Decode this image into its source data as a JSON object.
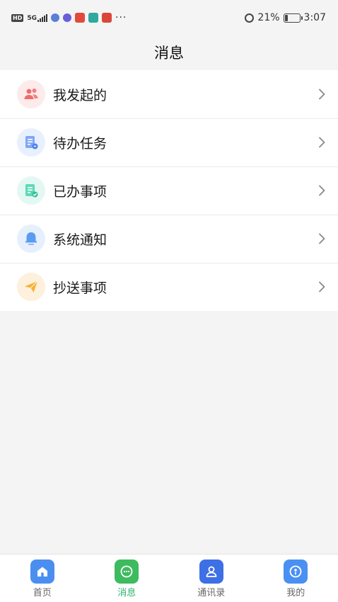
{
  "status_bar": {
    "signal_label": "5G",
    "battery": "21%",
    "time": "3:07",
    "more": "···",
    "battery_level": 0.21
  },
  "header": {
    "title": "消息"
  },
  "menu": {
    "items": [
      {
        "label": "我发起的",
        "icon": "users-icon",
        "color": "#f06b6b",
        "bg": "#fdeaea"
      },
      {
        "label": "待办任务",
        "icon": "task-doc-icon",
        "color": "#6f9ef5",
        "bg": "#e8f0fd"
      },
      {
        "label": "已办事项",
        "icon": "done-doc-icon",
        "color": "#3ecfa8",
        "bg": "#e3f8f3"
      },
      {
        "label": "系统通知",
        "icon": "bell-icon",
        "color": "#5b9cf2",
        "bg": "#e6effc"
      },
      {
        "label": "抄送事项",
        "icon": "paper-plane-icon",
        "color": "#f5b233",
        "bg": "#fdf0dc"
      }
    ]
  },
  "tabbar": {
    "tabs": [
      {
        "label": "首页",
        "icon": "home-icon",
        "color": "#4a8ff0"
      },
      {
        "label": "消息",
        "icon": "message-icon",
        "color": "#3dbb5f"
      },
      {
        "label": "通讯录",
        "icon": "contacts-icon",
        "color": "#3d6fe5"
      },
      {
        "label": "我的",
        "icon": "profile-icon",
        "color": "#4a90f2"
      }
    ],
    "active": "消息"
  }
}
